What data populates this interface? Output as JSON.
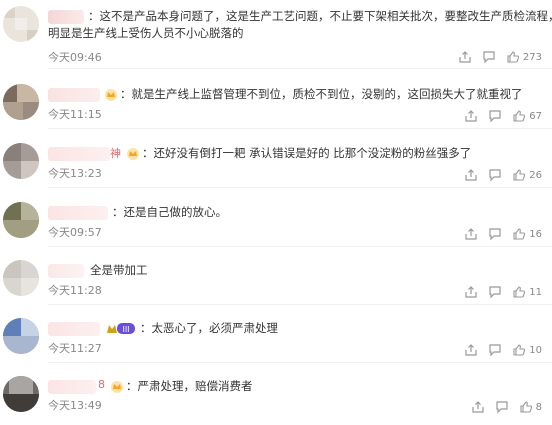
{
  "comments": [
    {
      "text": "：这不是产品本身问题了，这是生产工艺问题，不止要下架相关批次，要整改生产质检流程，",
      "text2": "明显是生产线上受伤人员不小心脱落的",
      "time": "今天09:46",
      "likes": "273"
    },
    {
      "text": "：就是生产线上监督管理不到位，质检不到位，没剔的，这回损失大了就重视了",
      "time": "今天11:15",
      "likes": "67"
    },
    {
      "text": "：还好没有倒打一耙 承认错误是好的 比那个没淀粉的粉丝强多了",
      "name_frag": "神",
      "time": "今天13:23",
      "likes": "26"
    },
    {
      "text": "：还是自己做的放心。",
      "time": "今天09:57",
      "likes": "16"
    },
    {
      "text": "全是带加工",
      "time": "今天11:28",
      "likes": "11"
    },
    {
      "text": "：太恶心了，必须严肃处理",
      "time": "今天11:27",
      "likes": "10"
    },
    {
      "text": "：严肃处理，赔偿消费者",
      "name_frag": "8",
      "time": "今天13:49",
      "likes": "8"
    }
  ],
  "icons": {
    "more": "share-icon",
    "comment": "comment-icon",
    "like": "thumbs-up-icon"
  },
  "colors": {
    "crown": "#f5a623",
    "badge": "#6b4fd6",
    "text": "#333333",
    "time": "#888888"
  }
}
